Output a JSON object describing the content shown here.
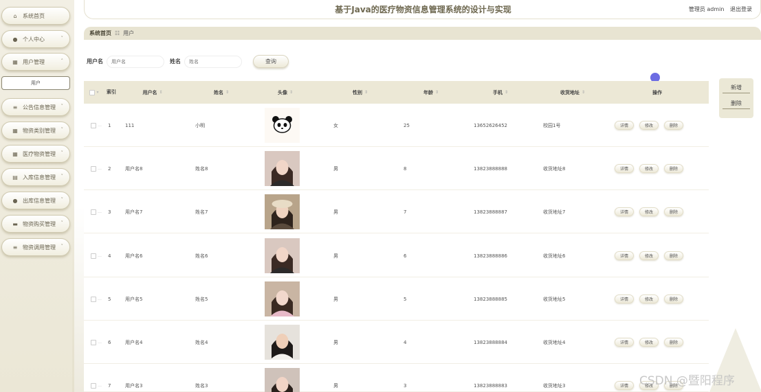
{
  "header": {
    "title": "基于Java的医疗物资信息管理系统的设计与实现",
    "user": "管理员 admin",
    "logout": "退出登录"
  },
  "sidebar": {
    "items": [
      {
        "label": "系统首页",
        "icon": "home-icon",
        "chev": ""
      },
      {
        "label": "个人中心",
        "icon": "user-icon",
        "chev": "˅"
      },
      {
        "label": "用户管理",
        "icon": "grid-icon",
        "chev": "˄"
      },
      {
        "label": "公告信息管理",
        "icon": "list-icon",
        "chev": "˅"
      },
      {
        "label": "物资类别管理",
        "icon": "grid-icon",
        "chev": "˅"
      },
      {
        "label": "医疗物资管理",
        "icon": "grid-icon",
        "chev": "˅"
      },
      {
        "label": "入库信息管理",
        "icon": "clipboard-icon",
        "chev": "˅"
      },
      {
        "label": "出库信息管理",
        "icon": "pin-icon",
        "chev": "˅"
      },
      {
        "label": "物资购买管理",
        "icon": "database-icon",
        "chev": "˅"
      },
      {
        "label": "物资调用管理",
        "icon": "list-icon",
        "chev": "˅"
      }
    ],
    "sub_item": "用户"
  },
  "breadcrumb": {
    "home": "系统首页",
    "sep": "☷",
    "current": "用户"
  },
  "search": {
    "username_label": "用户名",
    "username_placeholder": "用户名",
    "name_label": "姓名",
    "name_placeholder": "姓名",
    "button": "查询"
  },
  "actions": {
    "add": "新增",
    "delete": "删除"
  },
  "table": {
    "headers": {
      "index": "索引",
      "username": "用户名",
      "name": "姓名",
      "avatar": "头像",
      "gender": "性别",
      "age": "年龄",
      "phone": "手机",
      "address": "收货地址",
      "ops": "操作"
    },
    "sort_glyph": "⇕",
    "op_labels": {
      "detail": "详情",
      "edit": "修改",
      "delete": "删除"
    },
    "rows": [
      {
        "index": "1",
        "username": "111",
        "name": "小明",
        "gender": "女",
        "age": "25",
        "phone": "13652626452",
        "address": "校园1号",
        "avatar": "panda"
      },
      {
        "index": "2",
        "username": "用户名8",
        "name": "姓名8",
        "gender": "男",
        "age": "8",
        "phone": "13823888888",
        "address": "收货地址8",
        "avatar": "photo-a"
      },
      {
        "index": "3",
        "username": "用户名7",
        "name": "姓名7",
        "gender": "男",
        "age": "7",
        "phone": "13823888887",
        "address": "收货地址7",
        "avatar": "photo-b"
      },
      {
        "index": "4",
        "username": "用户名6",
        "name": "姓名6",
        "gender": "男",
        "age": "6",
        "phone": "13823888886",
        "address": "收货地址6",
        "avatar": "photo-a"
      },
      {
        "index": "5",
        "username": "用户名5",
        "name": "姓名5",
        "gender": "男",
        "age": "5",
        "phone": "13823888885",
        "address": "收货地址5",
        "avatar": "photo-c"
      },
      {
        "index": "6",
        "username": "用户名4",
        "name": "姓名4",
        "gender": "男",
        "age": "4",
        "phone": "13823888884",
        "address": "收货地址4",
        "avatar": "photo-d"
      },
      {
        "index": "7",
        "username": "用户名3",
        "name": "姓名3",
        "gender": "男",
        "age": "3",
        "phone": "13823888883",
        "address": "收货地址3",
        "avatar": "photo-e"
      }
    ]
  },
  "watermark": "CSDN @暨阳程序"
}
